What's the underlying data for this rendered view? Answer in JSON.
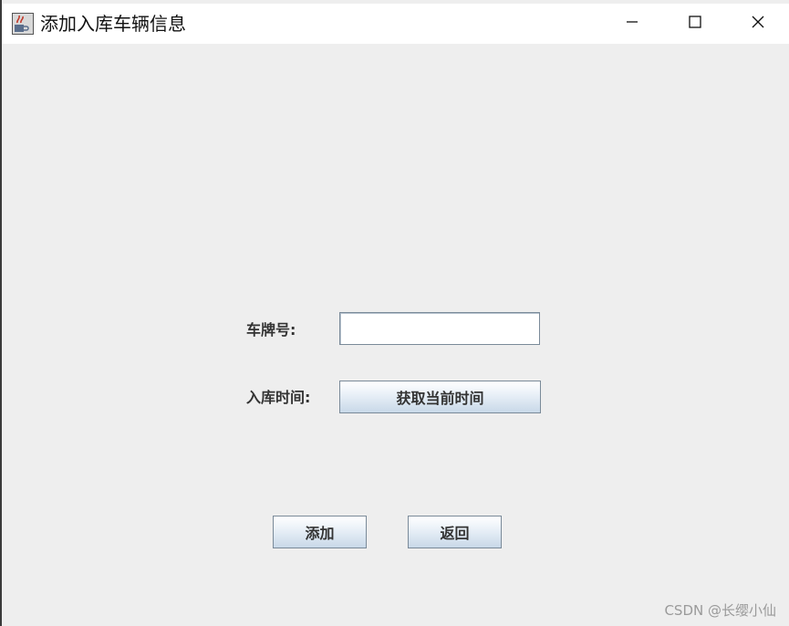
{
  "window": {
    "title": "添加入库车辆信息"
  },
  "form": {
    "plate_label": "车牌号:",
    "plate_value": "",
    "time_label": "入库时间:",
    "get_time_button": "获取当前时间"
  },
  "actions": {
    "add_label": "添加",
    "back_label": "返回"
  },
  "watermark": "CSDN @长缨小仙",
  "icons": {
    "app": "java-cup-icon",
    "minimize": "minimize-icon",
    "maximize": "maximize-icon",
    "close": "close-icon"
  }
}
